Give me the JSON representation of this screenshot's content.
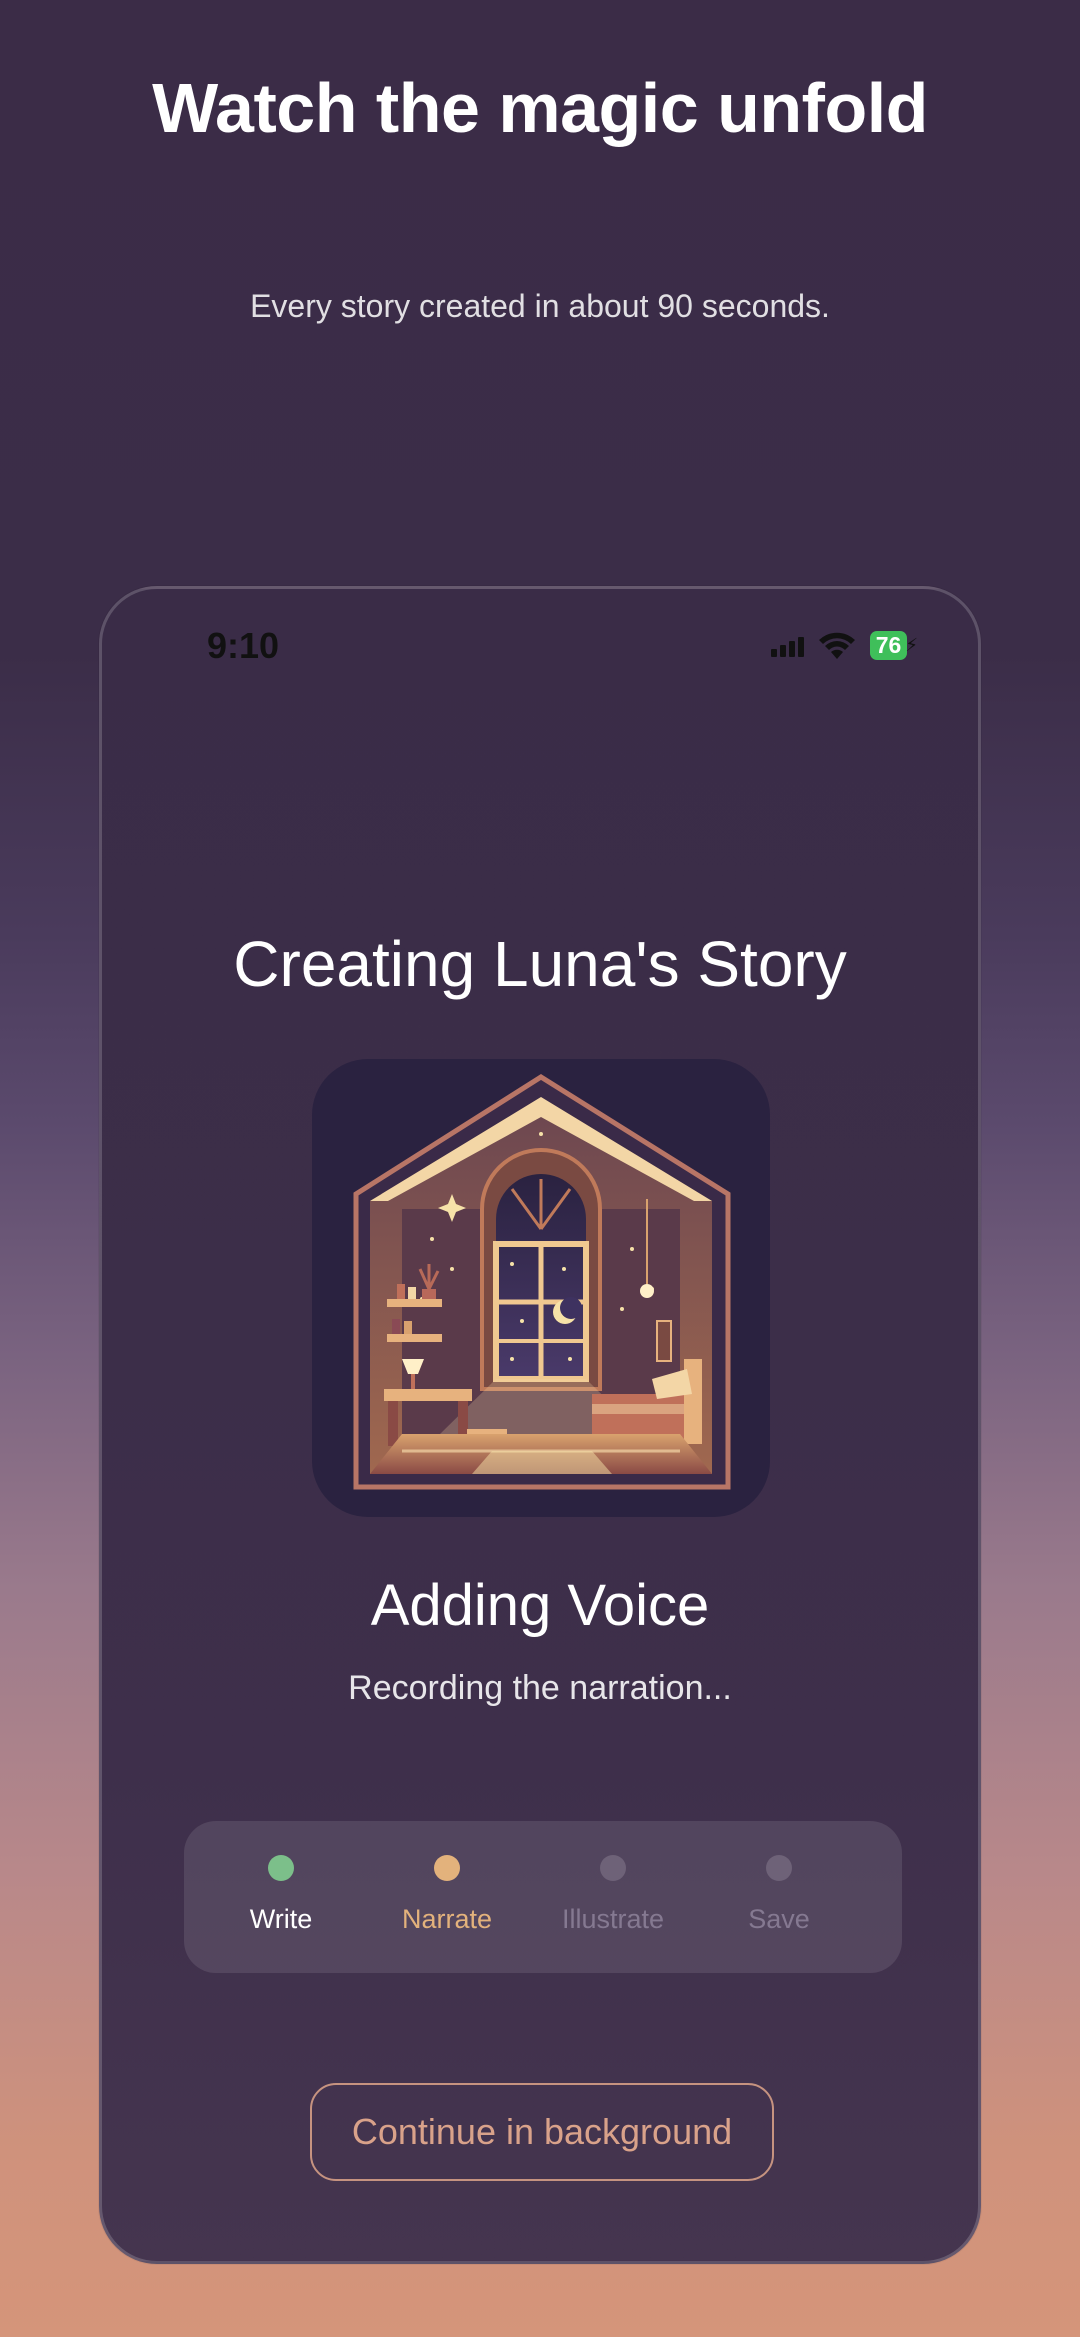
{
  "header": {
    "title": "Watch the magic unfold",
    "subtitle": "Every story created in about 90 seconds."
  },
  "phone": {
    "status_bar": {
      "time": "9:10",
      "battery": "76",
      "icons": [
        "cellular-signal-icon",
        "wifi-icon",
        "battery-charging-icon"
      ]
    },
    "title": "Creating Luna's Story",
    "illustration": {
      "description_icon": "cozy-bedroom-illustration"
    },
    "current_step": {
      "title": "Adding Voice",
      "description": "Recording the narration..."
    },
    "steps": [
      {
        "label": "Write",
        "state": "done",
        "color": "#7cbf8a"
      },
      {
        "label": "Narrate",
        "state": "active",
        "color": "#e3b27c"
      },
      {
        "label": "Illustrate",
        "state": "pending",
        "color": "#6e6278"
      },
      {
        "label": "Save",
        "state": "pending",
        "color": "#6e6278"
      }
    ],
    "continue_button": "Continue in background"
  },
  "colors": {
    "background_top": "#3b2c47",
    "background_bottom": "#d5957a",
    "accent": "#e3b27c",
    "done": "#7cbf8a",
    "button_text": "#d9a28a"
  }
}
